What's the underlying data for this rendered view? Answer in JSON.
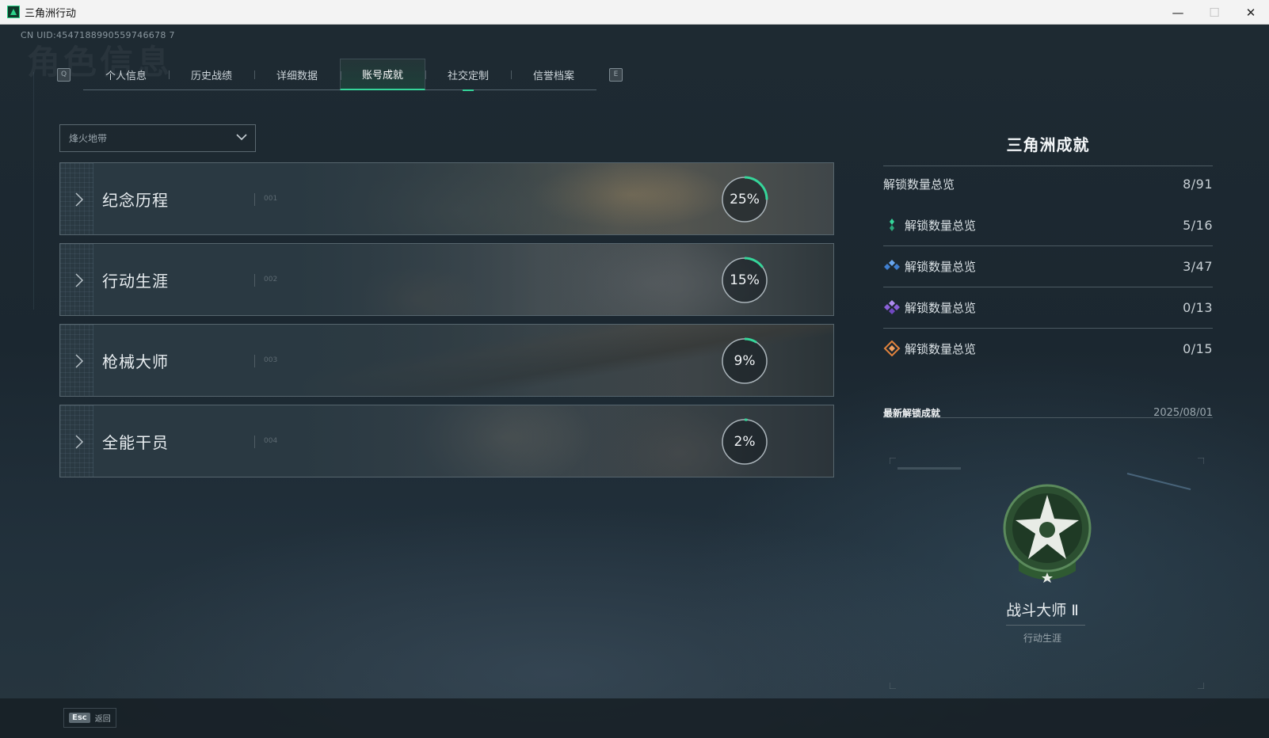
{
  "window": {
    "title": "三角洲行动",
    "minimize": "—",
    "maximize": "☐",
    "close": "✕"
  },
  "header": {
    "uid": "CN UID:4547188990559746678 7",
    "background_title": "角色信息"
  },
  "tabs": {
    "prev_key": "Q",
    "next_key": "E",
    "items": [
      {
        "label": "个人信息"
      },
      {
        "label": "历史战绩"
      },
      {
        "label": "详细数据"
      },
      {
        "label": "账号成就",
        "active": true
      },
      {
        "label": "社交定制"
      },
      {
        "label": "信誉档案"
      }
    ]
  },
  "filter": {
    "selected": "烽火地带"
  },
  "categories": [
    {
      "name": "纪念历程",
      "code": "001",
      "percent": "25%",
      "progress": 0.25
    },
    {
      "name": "行动生涯",
      "code": "002",
      "percent": "15%",
      "progress": 0.15
    },
    {
      "name": "枪械大师",
      "code": "003",
      "percent": "9%",
      "progress": 0.09
    },
    {
      "name": "全能干员",
      "code": "004",
      "percent": "2%",
      "progress": 0.02
    }
  ],
  "panel": {
    "title": "三角洲成就",
    "total": {
      "label": "解锁数量总览",
      "value": "8/91"
    },
    "tiers": [
      {
        "label": "解锁数量总览",
        "value": "5/16",
        "icon": "green-gem-icon",
        "color": "#35d69a"
      },
      {
        "label": "解锁数量总览",
        "value": "3/47",
        "icon": "blue-gem-icon",
        "color": "#4f8fe0"
      },
      {
        "label": "解锁数量总览",
        "value": "0/13",
        "icon": "purple-gem-icon",
        "color": "#9a6ee0"
      },
      {
        "label": "解锁数量总览",
        "value": "0/15",
        "icon": "orange-gem-icon",
        "color": "#e0823c"
      }
    ],
    "recent": {
      "title": "最新解锁成就",
      "date": "2025/08/01",
      "achievement_name": "战斗大师 Ⅱ",
      "achievement_category": "行动生涯"
    }
  },
  "footer": {
    "esc_key": "Esc",
    "esc_label": "返回"
  },
  "colors": {
    "accent": "#35d69a",
    "background": "#1e2a32"
  }
}
